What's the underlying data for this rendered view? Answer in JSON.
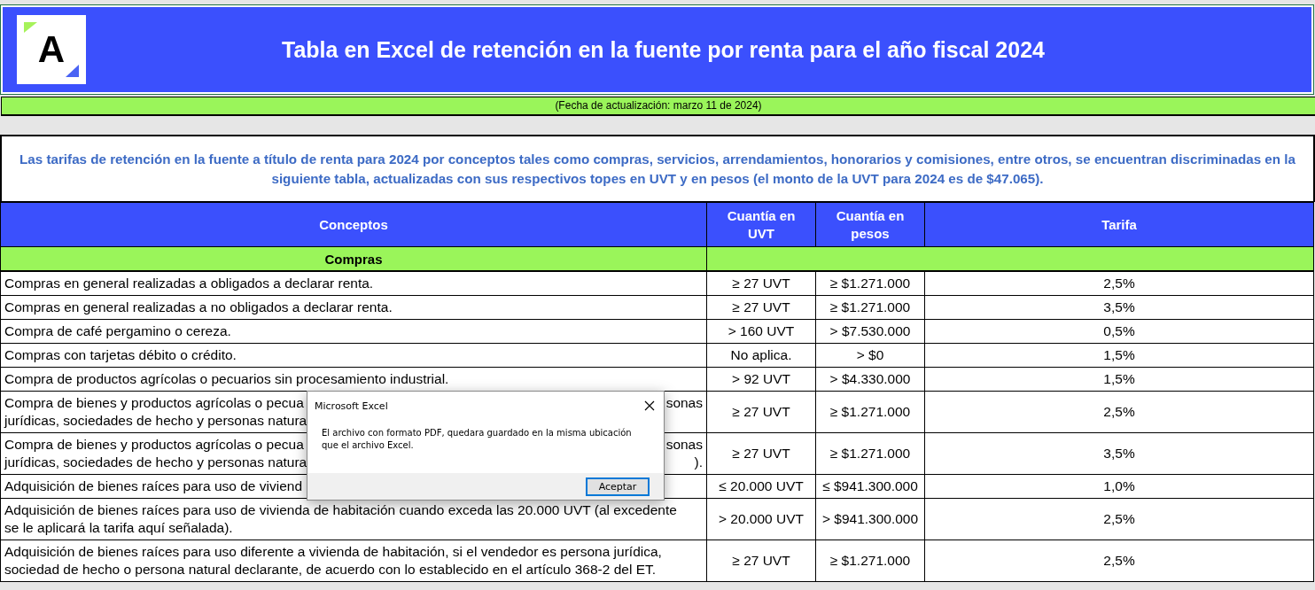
{
  "header": {
    "logo_text": "A",
    "title": "Tabla en Excel de retención en la fuente por renta para el año fiscal 2024"
  },
  "update_note": "(Fecha de actualización: marzo 11 de 2024)",
  "intro": "Las tarifas de retención en la fuente a título de renta para 2024 por conceptos tales como compras, servicios, arrendamientos, honorarios y comisiones, entre otros, se encuentran discriminadas en la siguiente tabla, actualizadas con sus respectivos topes en UVT y en pesos (el monto de la UVT para 2024 es de $47.065).",
  "table": {
    "columns": [
      "Conceptos",
      "Cuantía en UVT",
      "Cuantía en pesos",
      "Tarifa"
    ],
    "section": "Compras",
    "rows": [
      {
        "concepto": [
          {
            "text": "Compras en general realizadas a obligados a declarar renta."
          }
        ],
        "uvt": "≥ 27 UVT",
        "pesos": "≥ $1.271.000",
        "tarifa": "2,5%"
      },
      {
        "concepto": [
          {
            "text": "Compras en general realizadas a no obligados a declarar renta."
          }
        ],
        "uvt": "≥ 27 UVT",
        "pesos": "≥ $1.271.000",
        "tarifa": "3,5%"
      },
      {
        "concepto": [
          {
            "text": "Compra de café pergamino o cereza."
          }
        ],
        "uvt": "> 160 UVT",
        "pesos": "> $7.530.000",
        "tarifa": "0,5%"
      },
      {
        "concepto": [
          {
            "text": "Compras con tarjetas débito o crédito."
          }
        ],
        "uvt": "No aplica.",
        "pesos": "> $0",
        "tarifa": "1,5%"
      },
      {
        "concepto": [
          {
            "text": "Compra de productos agrícolas o pecuarios sin procesamiento industrial."
          }
        ],
        "uvt": "> 92 UVT",
        "pesos": "> $4.330.000",
        "tarifa": "1,5%"
      },
      {
        "concepto": [
          {
            "text": "Compra de bienes y productos agrícolas o pecua",
            "tail": "sonas"
          },
          {
            "text": "jurídicas, sociedades de hecho y personas natura"
          }
        ],
        "uvt": "≥ 27 UVT",
        "pesos": "≥ $1.271.000",
        "tarifa": "2,5%"
      },
      {
        "concepto": [
          {
            "text": "Compra de bienes y productos agrícolas o pecua",
            "tail": "sonas"
          },
          {
            "text": "jurídicas, sociedades de hecho y personas natura",
            "tail": ")."
          }
        ],
        "uvt": "≥ 27 UVT",
        "pesos": "≥ $1.271.000",
        "tarifa": "3,5%"
      },
      {
        "concepto": [
          {
            "text": "Adquisición de bienes raíces para uso de viviend"
          }
        ],
        "uvt": "≤ 20.000 UVT",
        "pesos": "≤ $941.300.000",
        "tarifa": "1,0%"
      },
      {
        "concepto": [
          {
            "text": "Adquisición de bienes raíces para uso de vivienda de habitación cuando exceda las 20.000 UVT (al excedente"
          },
          {
            "text": "se le aplicará la tarifa aquí señalada)."
          }
        ],
        "uvt": "> 20.000 UVT",
        "pesos": "> $941.300.000",
        "tarifa": "2,5%"
      },
      {
        "concepto": [
          {
            "text": "Adquisición de bienes raíces para uso diferente a vivienda de habitación, si el vendedor es persona jurídica,"
          },
          {
            "text": "sociedad de hecho o persona natural declarante, de acuerdo con lo establecido en el artículo 368-2 del ET."
          }
        ],
        "uvt": "≥ 27 UVT",
        "pesos": "≥ $1.271.000",
        "tarifa": "2,5%"
      }
    ]
  },
  "dialog": {
    "title": "Microsoft Excel",
    "message": "El archivo con formato PDF, quedara guardado en la misma ubicación que el archivo Excel.",
    "button": "Aceptar"
  }
}
